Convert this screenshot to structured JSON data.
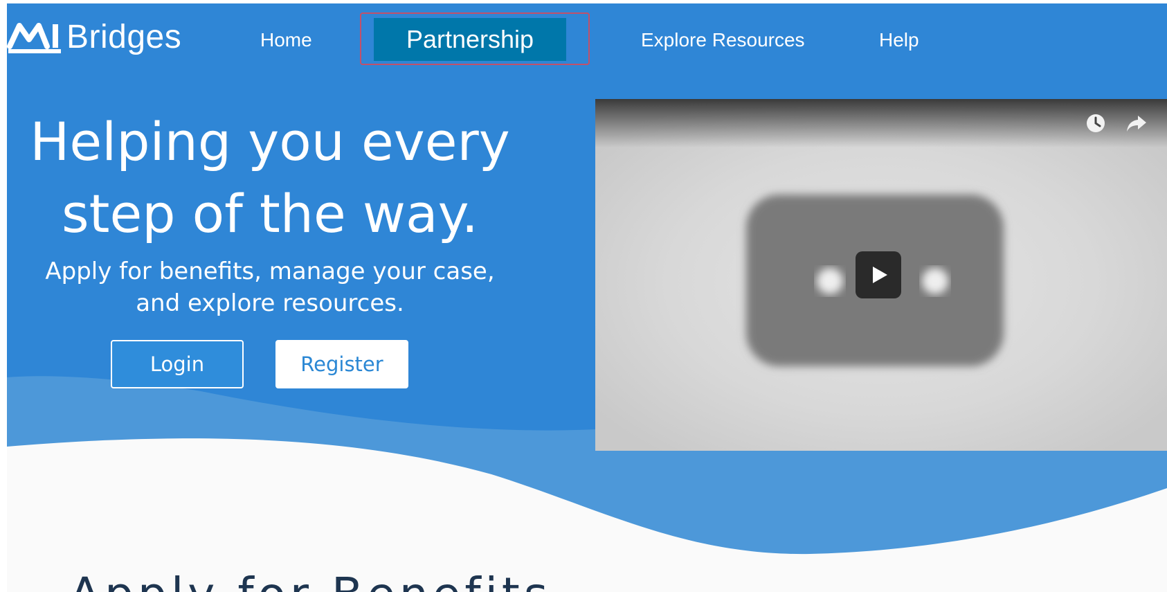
{
  "brand": {
    "name": "Bridges",
    "mark_text": "MI"
  },
  "nav": {
    "items": [
      {
        "label": "Home"
      },
      {
        "label": "Partnership"
      },
      {
        "label": "Explore Resources"
      },
      {
        "label": "Help"
      }
    ],
    "active": "Partnership"
  },
  "hero": {
    "headline_line1": "Helping you every",
    "headline_line2": "step of the way.",
    "sub_line1": "Apply for benefits, manage your case,",
    "sub_line2": "and explore resources.",
    "login_label": "Login",
    "register_label": "Register"
  },
  "video": {
    "icons": [
      "watch-later-icon",
      "share-icon",
      "play-icon"
    ]
  },
  "section": {
    "title": "Apply for Benefits"
  },
  "colors": {
    "hero_blue": "#2f86d6",
    "wave_light_blue": "#4d98d9",
    "active_nav_bg": "#0077aa",
    "active_nav_outline": "#c2506a",
    "section_title": "#1e3550"
  }
}
